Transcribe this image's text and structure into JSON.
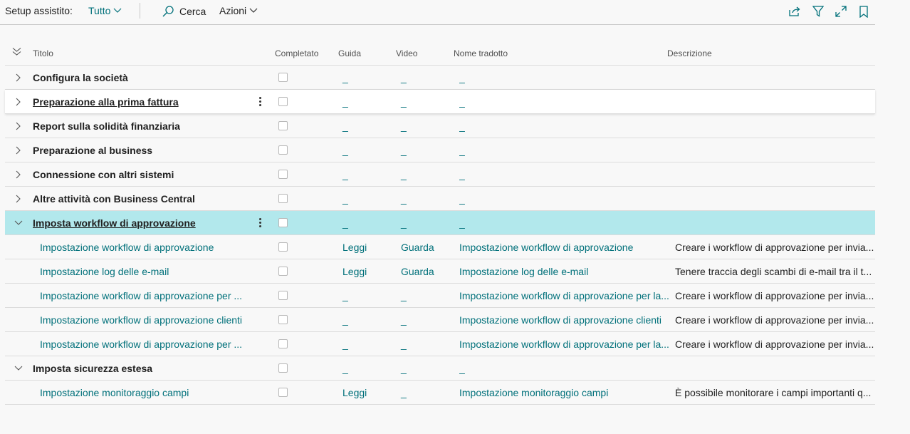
{
  "toolbar": {
    "title": "Setup assistito:",
    "filter_label": "Tutto",
    "search_label": "Cerca",
    "actions_label": "Azioni",
    "right_icons": [
      "share-icon",
      "filter-icon",
      "expand-icon",
      "bookmark-icon"
    ]
  },
  "columns": {
    "title": "Titolo",
    "completed": "Completato",
    "guide": "Guida",
    "video": "Video",
    "translated": "Nome tradotto",
    "description": "Descrizione"
  },
  "rows": [
    {
      "title": "Configura la società",
      "group": true,
      "expanded": false,
      "guide": "_",
      "video": "_",
      "name": "_",
      "desc": ""
    },
    {
      "title": "Preparazione alla prima fattura",
      "group": true,
      "expanded": false,
      "link": true,
      "selected": true,
      "guide": "_",
      "video": "_",
      "name": "_",
      "desc": ""
    },
    {
      "title": "Report sulla solidità finanziaria",
      "group": true,
      "expanded": false,
      "guide": "_",
      "video": "_",
      "name": "_",
      "desc": ""
    },
    {
      "title": "Preparazione al business",
      "group": true,
      "expanded": false,
      "guide": "_",
      "video": "_",
      "name": "_",
      "desc": ""
    },
    {
      "title": "Connessione con altri sistemi",
      "group": true,
      "expanded": false,
      "guide": "_",
      "video": "_",
      "name": "_",
      "desc": ""
    },
    {
      "title": "Altre attività con Business Central",
      "group": true,
      "expanded": false,
      "guide": "_",
      "video": "_",
      "name": "_",
      "desc": ""
    },
    {
      "title": "Imposta workflow di approvazione",
      "group": true,
      "expanded": true,
      "link": true,
      "active": true,
      "guide": "_",
      "video": "_",
      "name": "_",
      "desc": ""
    },
    {
      "title": "Impostazione workflow di approvazione",
      "group": false,
      "guide": "Leggi",
      "video": "Guarda",
      "name": "Impostazione workflow di approvazione",
      "desc": "Creare i workflow di approvazione per invia..."
    },
    {
      "title": "Impostazione log delle e-mail",
      "group": false,
      "guide": "Leggi",
      "video": "Guarda",
      "name": "Impostazione log delle e-mail",
      "desc": "Tenere traccia degli scambi di e-mail tra il t..."
    },
    {
      "title": "Impostazione workflow di approvazione per ...",
      "group": false,
      "guide": "_",
      "video": "_",
      "name": "Impostazione workflow di approvazione per la...",
      "desc": "Creare i workflow di approvazione per invia..."
    },
    {
      "title": "Impostazione workflow di approvazione clienti",
      "group": false,
      "guide": "_",
      "video": "_",
      "name": "Impostazione workflow di approvazione clienti",
      "desc": "Creare i workflow di approvazione per invia..."
    },
    {
      "title": "Impostazione workflow di approvazione per ...",
      "group": false,
      "guide": "_",
      "video": "_",
      "name": "Impostazione workflow di approvazione per la...",
      "desc": "Creare i workflow di approvazione per invia..."
    },
    {
      "title": "Imposta sicurezza estesa",
      "group": true,
      "expanded": true,
      "guide": "_",
      "video": "_",
      "name": "_",
      "desc": ""
    },
    {
      "title": "Impostazione monitoraggio campi",
      "group": false,
      "guide": "Leggi",
      "video": "_",
      "name": "Impostazione monitoraggio campi",
      "desc": "È possibile monitorare i campi importanti q..."
    }
  ]
}
